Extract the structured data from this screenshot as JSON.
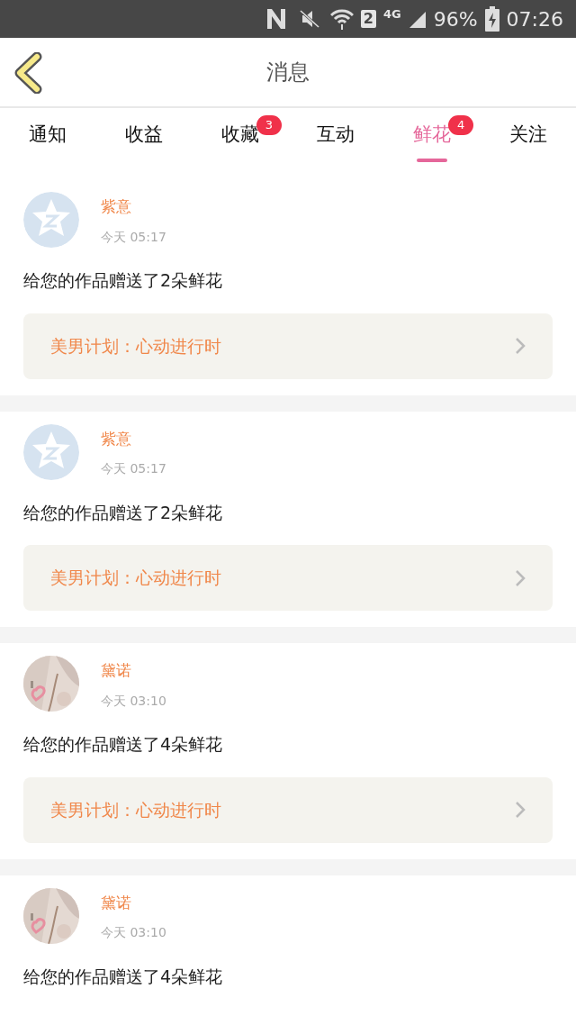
{
  "status_bar": {
    "sim": "2",
    "network": "4G",
    "battery": "96%",
    "time": "07:26"
  },
  "header": {
    "title": "消息"
  },
  "tabs": [
    {
      "label": "通知",
      "selected": false
    },
    {
      "label": "收益",
      "selected": false
    },
    {
      "label": "收藏",
      "selected": false,
      "badge": "3"
    },
    {
      "label": "互动",
      "selected": false
    },
    {
      "label": "鲜花",
      "selected": true,
      "badge": "4"
    },
    {
      "label": "关注",
      "selected": false
    }
  ],
  "messages": [
    {
      "avatar": {
        "kind": "default"
      },
      "name": "紫意",
      "time": "今天 05:17",
      "text": "给您的作品赠送了2朵鲜花",
      "work": "美男计划：心动进行时"
    },
    {
      "avatar": {
        "kind": "default"
      },
      "name": "紫意",
      "time": "今天 05:17",
      "text": "给您的作品赠送了2朵鲜花",
      "work": "美男计划：心动进行时"
    },
    {
      "name": "黛诺",
      "time": "今天 03:10",
      "text": "给您的作品赠送了4朵鲜花",
      "work": "美男计划：心动进行时"
    },
    {
      "name": "黛诺",
      "time": "今天 03:10",
      "text": "给您的作品赠送了4朵鲜花"
    }
  ]
}
